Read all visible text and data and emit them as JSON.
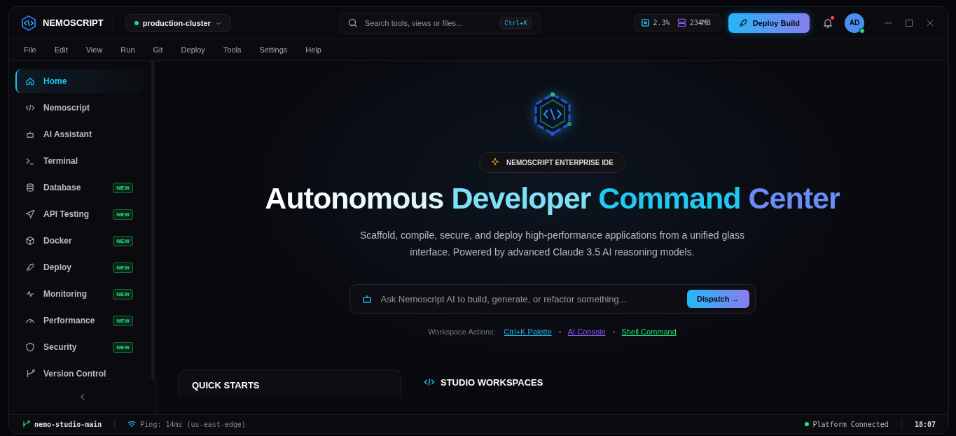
{
  "app": {
    "name": "NEMOSCRIPT"
  },
  "cluster": {
    "name": "production-cluster",
    "online": true
  },
  "search": {
    "placeholder": "Search tools, views or files...",
    "shortcut": "Ctrl+K"
  },
  "stats": {
    "cpu": "2.3%",
    "memory": "234MB"
  },
  "deploy_button": "Deploy Build",
  "notifications": {
    "unread": true
  },
  "avatar": {
    "initials": "AD",
    "online": true
  },
  "menu": [
    "File",
    "Edit",
    "View",
    "Run",
    "Git",
    "Deploy",
    "Tools",
    "Settings",
    "Help"
  ],
  "sidebar": {
    "items": [
      {
        "label": "Home",
        "kind": "home",
        "selected": true
      },
      {
        "label": "Nemoscript",
        "kind": "code",
        "selected": false
      },
      {
        "label": "AI Assistant",
        "kind": "bot",
        "selected": false
      },
      {
        "label": "Terminal",
        "kind": "terminal",
        "selected": false
      },
      {
        "label": "Database",
        "kind": "database",
        "selected": false,
        "badge": "NEW"
      },
      {
        "label": "API Testing",
        "kind": "send",
        "selected": false,
        "badge": "NEW"
      },
      {
        "label": "Docker",
        "kind": "box",
        "selected": false,
        "badge": "NEW"
      },
      {
        "label": "Deploy",
        "kind": "rocket",
        "selected": false,
        "badge": "NEW"
      },
      {
        "label": "Monitoring",
        "kind": "pulse",
        "selected": false,
        "badge": "NEW"
      },
      {
        "label": "Performance",
        "kind": "gauge",
        "selected": false,
        "badge": "NEW"
      },
      {
        "label": "Security",
        "kind": "shield",
        "selected": false,
        "badge": "NEW"
      },
      {
        "label": "Version Control",
        "kind": "branch",
        "selected": false
      }
    ]
  },
  "hero": {
    "badge": "NEMOSCRIPT ENTERPRISE IDE",
    "title": [
      "Autonomous",
      "Developer",
      "Command",
      "Center"
    ],
    "subtitle": "Scaffold, compile, secure, and deploy high-performance applications from a unified glass interface. Powered by advanced Claude 3.5 AI reasoning models.",
    "prompt": {
      "placeholder": "Ask Nemoscript AI to build, generate, or refactor something...",
      "button": "Dispatch →"
    },
    "actions_label": "Workspace Actions:",
    "actions": [
      {
        "label": "Ctrl+K Palette",
        "color": "#22b8f0"
      },
      {
        "label": "AI Console",
        "color": "#8b5cf6"
      },
      {
        "label": "Shell Command",
        "color": "#22e07a"
      }
    ]
  },
  "quick_starts": {
    "title": "QUICK STARTS"
  },
  "workspaces": {
    "title": "STUDIO WORKSPACES"
  },
  "status_bar": {
    "branch": "nemo-studio-main",
    "ping": "Ping: 14ms (us-east-edge)",
    "platform": "Platform Connected",
    "platform_ok": true,
    "time": "18:07"
  }
}
